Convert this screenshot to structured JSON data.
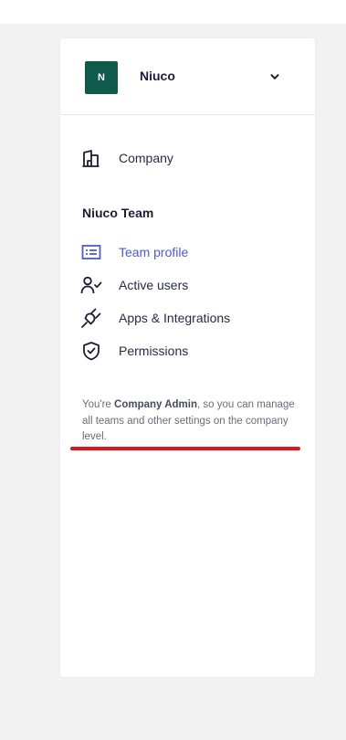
{
  "team_switcher": {
    "avatar_initial": "N",
    "team_name": "Niuco",
    "avatar_color": "#0f5a4b"
  },
  "company_nav": {
    "label": "Company",
    "icon": "building-icon"
  },
  "team_section": {
    "title": "Niuco Team",
    "items": [
      {
        "label": "Team profile",
        "icon": "id-card-icon",
        "active": true
      },
      {
        "label": "Active users",
        "icon": "user-check-icon",
        "active": false
      },
      {
        "label": "Apps & Integrations",
        "icon": "plug-icon",
        "active": false
      },
      {
        "label": "Permissions",
        "icon": "shield-check-icon",
        "active": false
      }
    ]
  },
  "admin_note": {
    "prefix": "You're ",
    "role": "Company Admin",
    "suffix": ", so you can manage all teams and other settings on the company level."
  },
  "colors": {
    "accent": "#4a5bd4",
    "text": "#2a2849",
    "annotation_red": "#e0141e"
  }
}
